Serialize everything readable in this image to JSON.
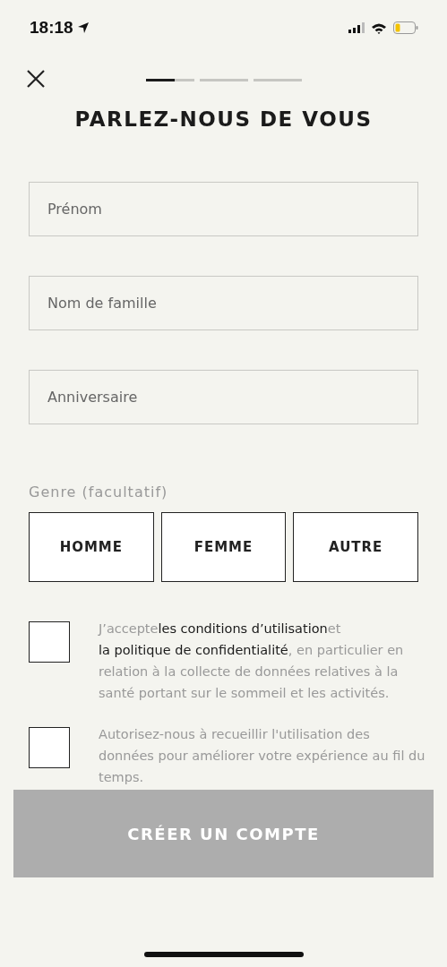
{
  "status_bar": {
    "time": "18:18"
  },
  "header": {
    "progress": [
      {
        "level": 0.6
      },
      {
        "level": 0
      },
      {
        "level": 0
      }
    ],
    "title": "PARLEZ-NOUS DE VOUS"
  },
  "fields": [
    {
      "placeholder": "Prénom"
    },
    {
      "placeholder": "Nom de famille"
    },
    {
      "placeholder": "Anniversaire"
    }
  ],
  "gender": {
    "label": "Genre (facultatif)",
    "options": [
      {
        "label": "HOMME",
        "selected": false
      },
      {
        "label": "FEMME",
        "selected": false
      },
      {
        "label": "AUTRE",
        "selected": false
      }
    ]
  },
  "consents": [
    {
      "checked": false,
      "segments": [
        {
          "kind": "text",
          "text": "J’accepte"
        },
        {
          "kind": "link",
          "text": "les conditions d’utilisation"
        },
        {
          "kind": "text",
          "text": "et"
        },
        {
          "kind": "link",
          "text": "la politique de confidentialité"
        },
        {
          "kind": "text",
          "text": ", en particulier en relation à la collecte de données relatives à la santé portant sur le sommeil et les activités."
        }
      ]
    },
    {
      "checked": false,
      "segments": [
        {
          "kind": "text",
          "text": "Autorisez-nous à recueillir l'utilisation des données pour améliorer votre expérience au fil du temps."
        }
      ]
    }
  ],
  "submit": {
    "label": "CRÉER UN COMPTE",
    "disabled": true
  }
}
